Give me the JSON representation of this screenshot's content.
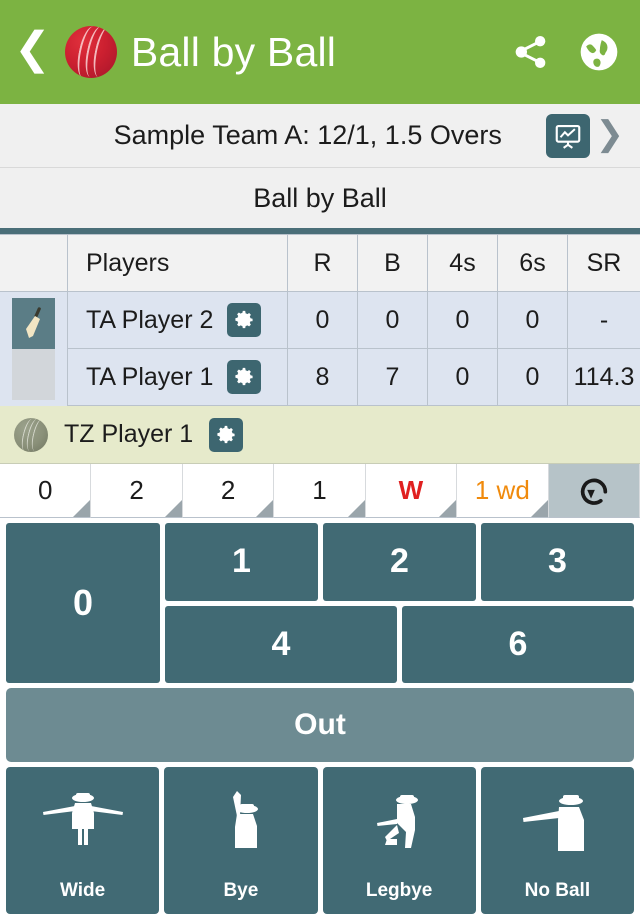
{
  "header": {
    "back_icon": "back-chevron-icon",
    "logo_icon": "cricket-ball-icon",
    "title": "Ball by Ball",
    "share_icon": "share-icon",
    "globe_icon": "globe-icon",
    "background_color": "#7cb342"
  },
  "score_bar": {
    "text": "Sample Team A: 12/1, 1.5 Overs",
    "chart_icon": "presentation-chart-icon",
    "next_icon": "chevron-right-icon"
  },
  "section": {
    "title": "Ball by Ball"
  },
  "batting_table": {
    "columns": [
      "Players",
      "R",
      "B",
      "4s",
      "6s",
      "SR"
    ],
    "rows": [
      {
        "on_strike": true,
        "strike_icon": "cricket-bat-icon",
        "name": "TA Player 2",
        "settings_icon": "gear-icon",
        "R": "0",
        "B": "0",
        "fours": "0",
        "sixes": "0",
        "SR": "-"
      },
      {
        "on_strike": false,
        "name": "TA Player 1",
        "settings_icon": "gear-icon",
        "R": "8",
        "B": "7",
        "fours": "0",
        "sixes": "0",
        "SR": "114.3"
      }
    ]
  },
  "bowler": {
    "ball_icon": "bowling-ball-icon",
    "name": "TZ Player 1",
    "settings_icon": "gear-icon",
    "background_color": "#e6eacb"
  },
  "ball_strip": {
    "balls": [
      {
        "label": "0",
        "kind": "run"
      },
      {
        "label": "2",
        "kind": "run"
      },
      {
        "label": "2",
        "kind": "run"
      },
      {
        "label": "1",
        "kind": "run"
      },
      {
        "label": "W",
        "kind": "wicket"
      },
      {
        "label": "1 wd",
        "kind": "extra"
      }
    ],
    "undo_icon": "undo-icon",
    "wicket_color": "#e02020",
    "extra_color": "#f08a0c"
  },
  "run_pad": {
    "zero": "0",
    "top_row": [
      "1",
      "2",
      "3"
    ],
    "bottom_row": [
      "4",
      "6"
    ],
    "out": "Out",
    "button_color": "#416a74",
    "out_color": "#6d8b92"
  },
  "extras": [
    {
      "label": "Wide",
      "icon": "umpire-wide-signal-icon"
    },
    {
      "label": "Bye",
      "icon": "umpire-bye-signal-icon"
    },
    {
      "label": "Legbye",
      "icon": "umpire-legbye-signal-icon"
    },
    {
      "label": "No Ball",
      "icon": "umpire-no-ball-signal-icon"
    }
  ]
}
